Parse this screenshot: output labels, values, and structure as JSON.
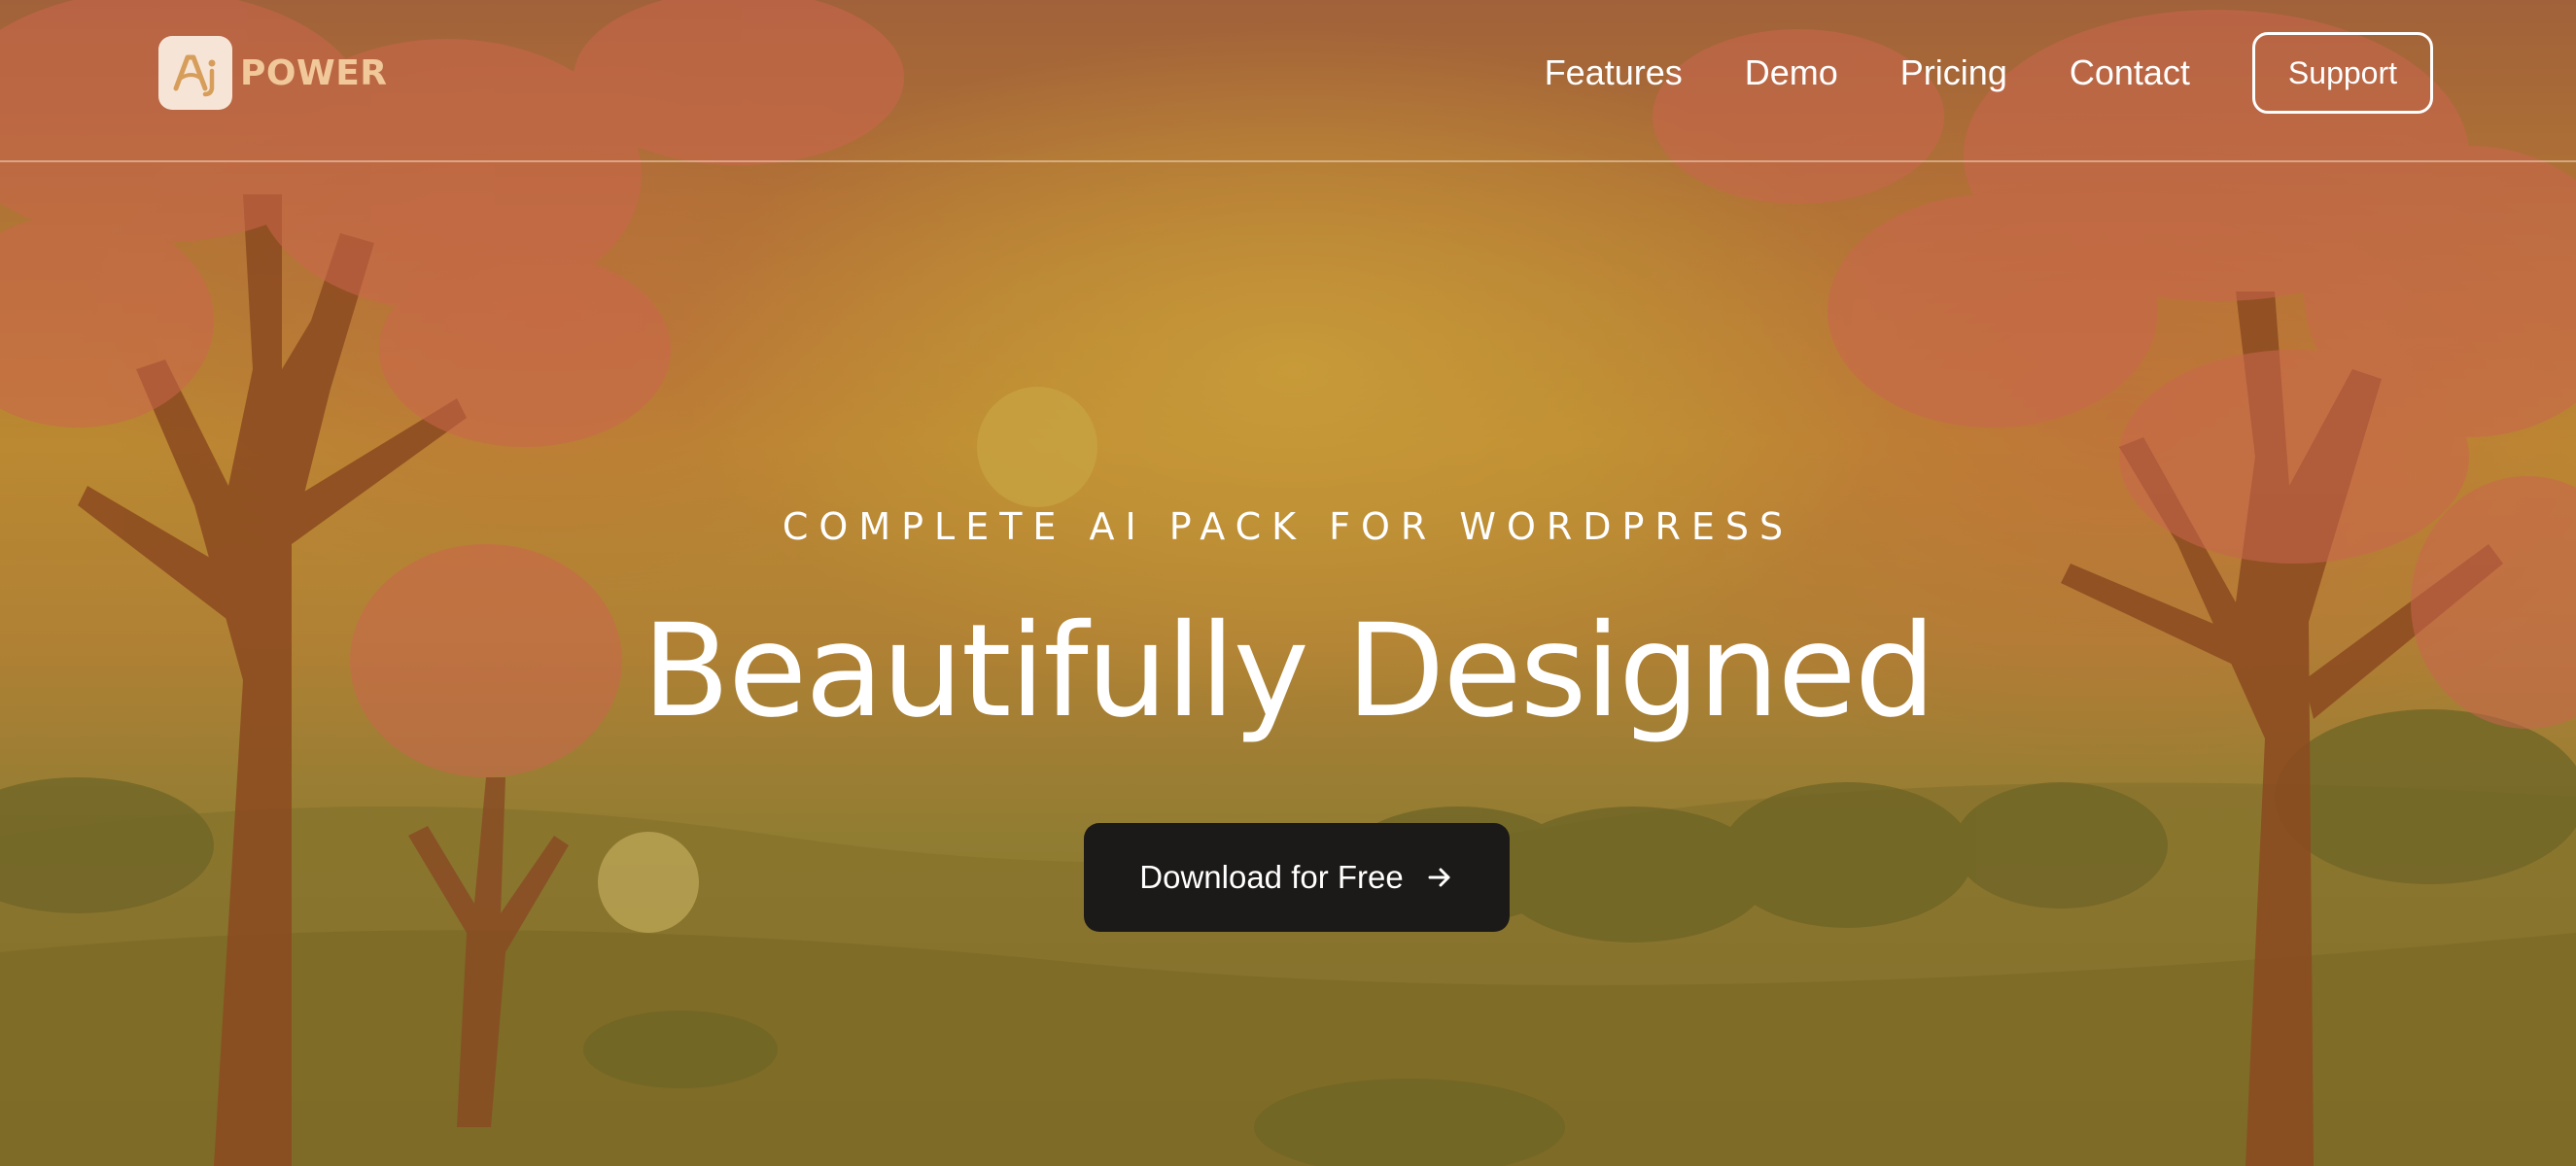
{
  "brand": {
    "logo_mark_text": "Ai",
    "name": "POWER",
    "mark_bg": "#f6e5d6",
    "mark_fg": "#d79e5b",
    "text_color": "#f0c89a"
  },
  "nav": {
    "items": [
      {
        "label": "Features"
      },
      {
        "label": "Demo"
      },
      {
        "label": "Pricing"
      },
      {
        "label": "Contact"
      }
    ],
    "support_label": "Support"
  },
  "hero": {
    "eyebrow": "COMPLETE AI PACK FOR WORDPRESS",
    "title": "Beautifully Designed",
    "cta_label": "Download for Free",
    "cta_icon": "arrow-right-icon",
    "cta_bg": "#1c1a18",
    "background_description_icon": "autumn-landscape-illustration"
  }
}
